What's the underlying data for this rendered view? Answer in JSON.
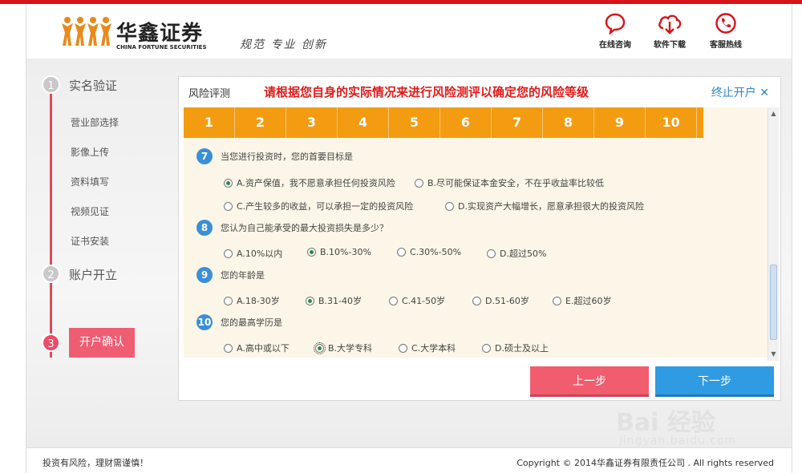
{
  "header": {
    "brand_cn": "华鑫证券",
    "brand_en": "CHINA FORTUNE SECURITIES",
    "slogan": "规范  专业  创新",
    "links": [
      {
        "label": "在线咨询",
        "icon": "chat-icon"
      },
      {
        "label": "软件下载",
        "icon": "cloud-download-icon"
      },
      {
        "label": "客服热线",
        "icon": "phone-icon"
      }
    ],
    "accent_color": "#d7141a"
  },
  "steps": {
    "main": [
      {
        "num": "1",
        "label": "实名验证"
      },
      {
        "num": "2",
        "label": "账户开立"
      },
      {
        "num": "3",
        "label": "开户确认"
      }
    ],
    "subs": [
      "营业部选择",
      "影像上传",
      "资料填写",
      "视频见证",
      "证书安装"
    ]
  },
  "panel": {
    "title": "风险评测",
    "message": "请根据您自身的实际情况来进行风险测评以确定您的风险等级",
    "stop_label": "终止开户 ✕",
    "numbers": [
      "1",
      "2",
      "3",
      "4",
      "5",
      "6",
      "7",
      "8",
      "9",
      "10"
    ],
    "questions": [
      {
        "num": "7",
        "text": "当您进行投资时，您的首要目标是",
        "options": [
          "A.资产保值，我不愿意承担任何投资风险",
          "B.尽可能保证本金安全，不在乎收益率比较低",
          "C.产生较多的收益，可以承担一定的投资风险",
          "D.实现资产大幅增长，愿意承担很大的投资风险"
        ],
        "selected": 0
      },
      {
        "num": "8",
        "text": "您认为自己能承受的最大投资损失是多少？",
        "options": [
          "A.10%以内",
          "B.10%-30%",
          "C.30%-50%",
          "D.超过50%"
        ],
        "selected": 1
      },
      {
        "num": "9",
        "text": "您的年龄是",
        "options": [
          "A.18-30岁",
          "B.31-40岁",
          "C.41-50岁",
          "D.51-60岁",
          "E.超过60岁"
        ],
        "selected": 1
      },
      {
        "num": "10",
        "text": "您的最高学历是",
        "options": [
          "A.高中或以下",
          "B.大学专科",
          "C.大学本科",
          "D.硕士及以上"
        ],
        "selected": 1
      }
    ],
    "prev_label": "上一步",
    "next_label": "下一步"
  },
  "footer": {
    "left": "投资有风险，理财需谨慎！",
    "right": "Copyright © 2014华鑫证券有限责任公司 . All rights reserved"
  },
  "watermark": {
    "text": "Bai 经验",
    "url": "jingyan.baidu.com"
  }
}
